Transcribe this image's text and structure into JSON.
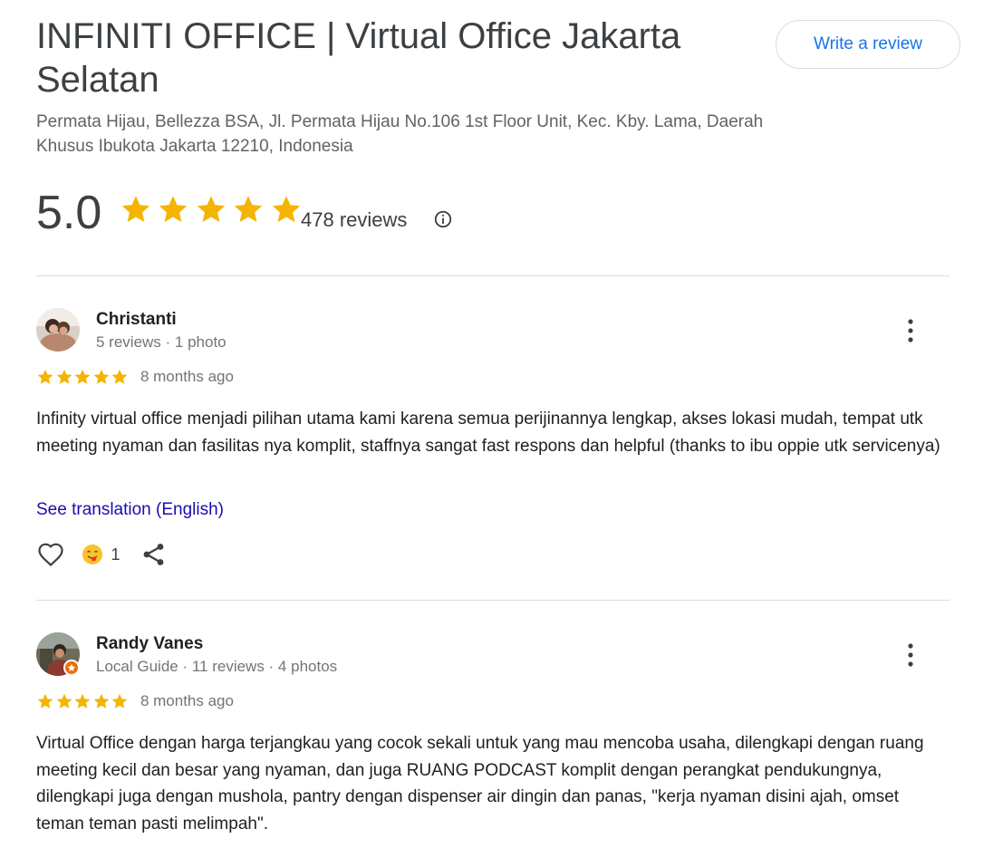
{
  "place": {
    "title": "INFINITI OFFICE | Virtual Office Jakarta Selatan",
    "address": "Permata Hijau, Bellezza BSA, Jl. Permata Hijau No.106 1st Floor Unit, Kec. Kby. Lama, Daerah Khusus Ibukota Jakarta 12210, Indonesia",
    "rating": "5.0",
    "rating_stars": 5,
    "review_count": "478 reviews",
    "write_review_label": "Write a review"
  },
  "colors": {
    "star": "#f4b400",
    "link": "#1a0dab",
    "accent": "#1a73e8",
    "guide_badge": "#e8710a"
  },
  "icons": {
    "info": "info-circle-icon",
    "more": "more-vertical-icon",
    "like": "heart-outline-icon",
    "reaction": "face-tongue-emoji",
    "share": "share-icon"
  },
  "reviews": [
    {
      "name": "Christanti",
      "meta": "5 reviews · 1 photo",
      "stars": 5,
      "date": "8 months ago",
      "text": "Infinity virtual office menjadi pilihan utama kami karena semua perijinannya lengkap, akses lokasi mudah, tempat utk meeting nyaman dan fasilitas nya komplit, staffnya sangat fast respons dan helpful (thanks to ibu oppie utk servicenya)",
      "translation_label": "See translation (English)",
      "reaction_count": "1",
      "local_guide": false
    },
    {
      "name": "Randy Vanes",
      "meta": "Local Guide · 11 reviews · 4 photos",
      "stars": 5,
      "date": "8 months ago",
      "text": "Virtual Office dengan harga terjangkau yang cocok sekali untuk yang mau mencoba usaha, dilengkapi dengan ruang meeting kecil dan besar yang nyaman, dan juga RUANG PODCAST komplit dengan perangkat pendukungnya, dilengkapi juga dengan mushola, pantry dengan dispenser air dingin dan panas, \"kerja nyaman disini ajah, omset teman teman pasti melimpah\".",
      "local_guide": true
    }
  ]
}
